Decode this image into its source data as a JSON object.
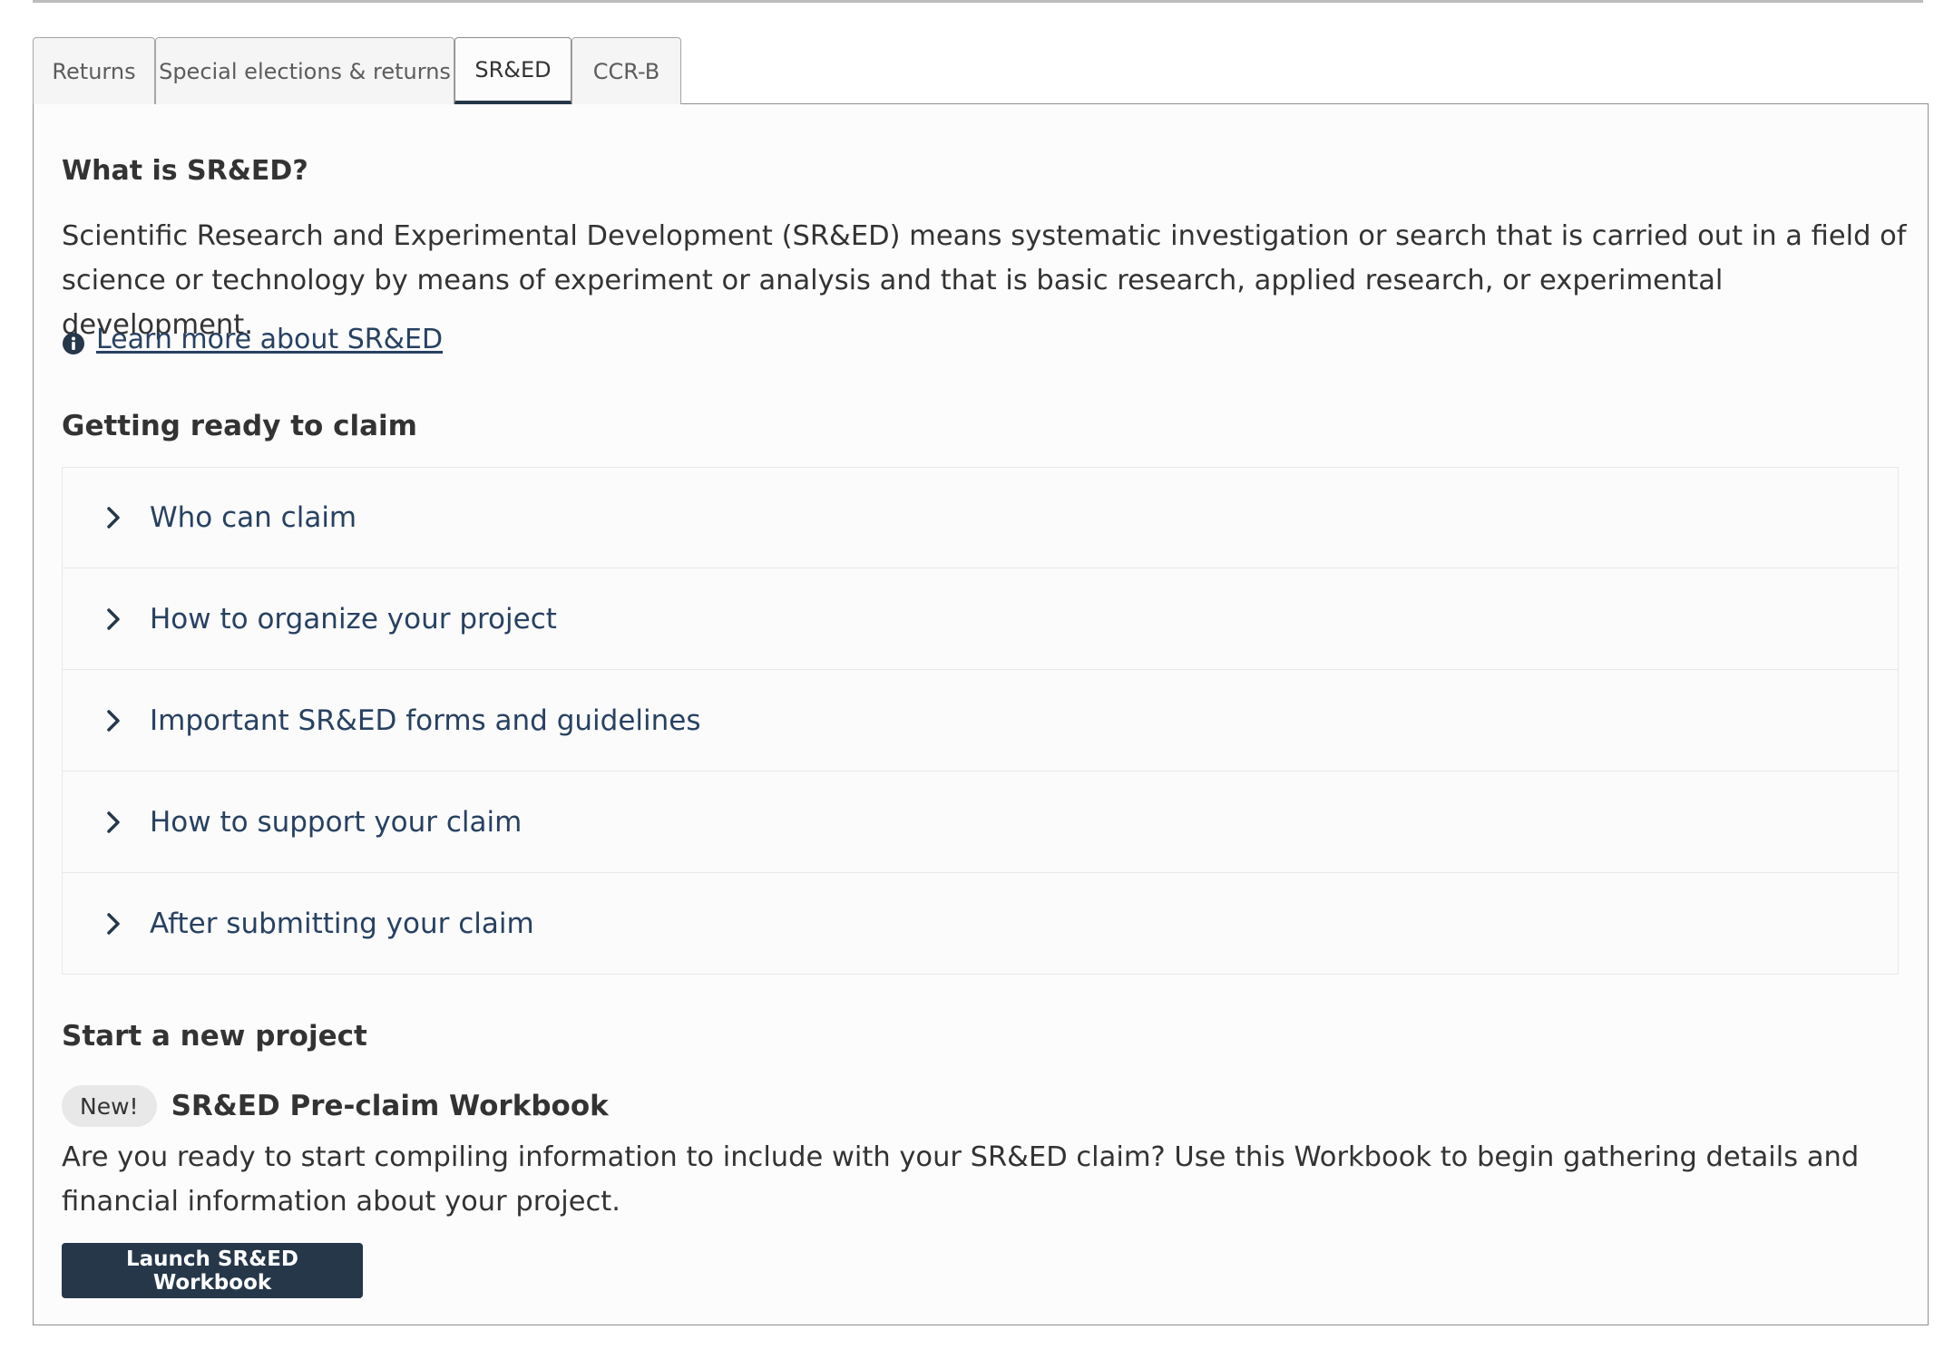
{
  "tabs": [
    {
      "label": "Returns",
      "active": false
    },
    {
      "label": "Special elections & returns",
      "active": false
    },
    {
      "label": "SR&ED",
      "active": true
    },
    {
      "label": "CCR-B",
      "active": false
    }
  ],
  "intro": {
    "heading": "What is SR&ED?",
    "body": "Scientific Research and Experimental Development (SR&ED) means systematic investigation or search that is carried out in a field of science or technology by means of experiment or analysis and that is basic research, applied research, or experimental development.",
    "learn_more_icon": "info-icon",
    "learn_more_label": "Learn more about SR&ED"
  },
  "getting_ready": {
    "heading": "Getting ready to claim",
    "items": [
      {
        "label": "Who can claim",
        "expanded": false
      },
      {
        "label": "How to organize your project",
        "expanded": false
      },
      {
        "label": "Important SR&ED forms and guidelines",
        "expanded": false
      },
      {
        "label": "How to support your claim",
        "expanded": false
      },
      {
        "label": "After submitting your claim",
        "expanded": false
      }
    ]
  },
  "new_project": {
    "heading": "Start a new project",
    "badge": "New!",
    "workbook_title": "SR&ED Pre-claim Workbook",
    "description": "Are you ready to start compiling information to include with your SR&ED claim? Use this Workbook to begin gathering details and financial information about your project.",
    "launch_label": "Launch SR&ED Workbook"
  },
  "colors": {
    "accent": "#26374a",
    "link": "#284162",
    "badge_bg": "#e8e8e8"
  }
}
